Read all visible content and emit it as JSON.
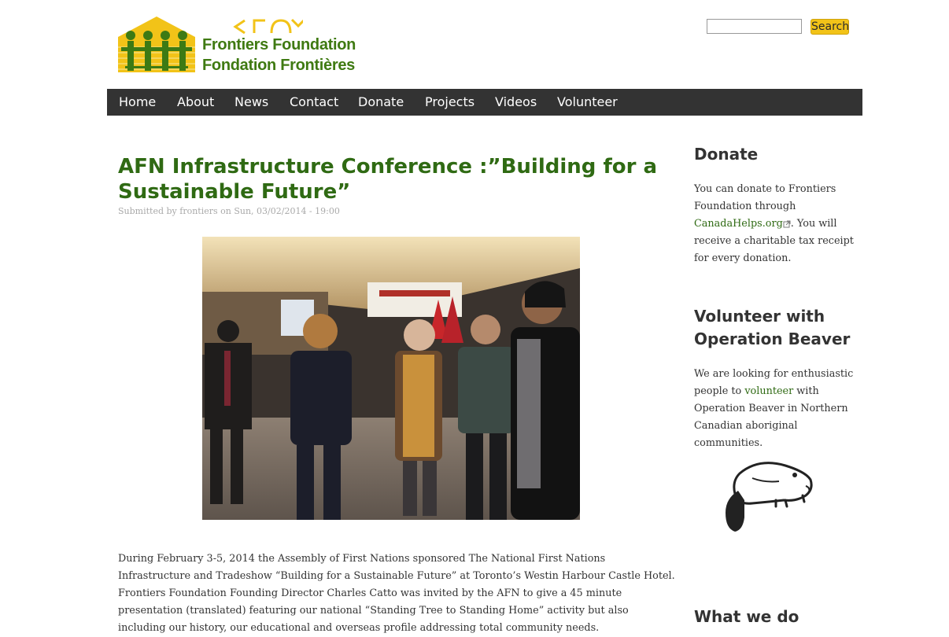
{
  "header": {
    "logo_name_en": "Frontiers Foundation",
    "logo_name_fr": "Fondation Frontières",
    "search": {
      "input_value": "",
      "button_label": "Search"
    }
  },
  "nav": {
    "items": [
      {
        "label": "Home"
      },
      {
        "label": "About"
      },
      {
        "label": "News"
      },
      {
        "label": "Contact"
      },
      {
        "label": "Donate"
      },
      {
        "label": "Projects"
      },
      {
        "label": "Videos"
      },
      {
        "label": "Volunteer"
      }
    ]
  },
  "article": {
    "title": "AFN Infrastructure Conference :”Building for a Sustainable Future”",
    "submitted": "Submitted by frontiers on Sun, 03/02/2014 - 19:00",
    "body": "During February 3-5, 2014 the Assembly of First Nations sponsored The National First Nations Infrastructure and Tradeshow “Building for a Sustainable Future” at Toronto’s Westin Harbour Castle Hotel. Frontiers Foundation Founding Director Charles Catto was invited by the AFN to give a 45 minute presentation (translated) featuring our national “Standing Tree to Standing Home” activity but also including our history, our educational and overseas profile addressing total community needs."
  },
  "sidebar": {
    "donate": {
      "title": "Donate",
      "text_before": "You can donate to Frontiers Foundation through ",
      "link": "CanadaHelps.org",
      "text_after": ". You will receive a charitable tax receipt for every donation."
    },
    "volunteer": {
      "title": "Volunteer with Operation Beaver",
      "text_before": "We are looking for enthusiastic people to ",
      "link": "volunteer",
      "text_after": " with Operation Beaver in Northern Canadian aboriginal communities."
    },
    "what_we_do": {
      "title": "What we do"
    }
  },
  "colors": {
    "brand_green": "#2f6a13",
    "logo_yellow": "#f2c318",
    "nav_background": "#333333"
  }
}
